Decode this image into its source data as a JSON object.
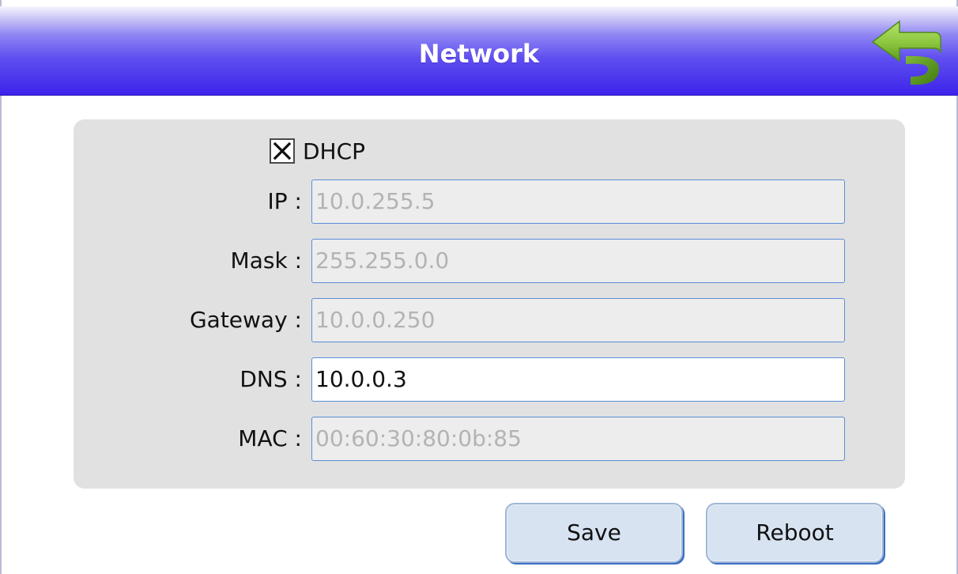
{
  "window": {
    "title": "Network"
  },
  "icons": {
    "back": "back-arrow-icon",
    "checkbox_mark": "x-check-icon"
  },
  "colors": {
    "titlebar_top": "#c9c4f6",
    "titlebar_bottom": "#3c22ea",
    "panel_bg": "#e1e1e1",
    "field_border": "#5b8ed6",
    "button_bg": "#d7e3f1",
    "back_arrow": "#8cc63f"
  },
  "form": {
    "dhcp": {
      "label": "DHCP",
      "checked": true
    },
    "ip": {
      "label": "IP :",
      "value": "10.0.255.5",
      "enabled": false
    },
    "mask": {
      "label": "Mask :",
      "value": "255.255.0.0",
      "enabled": false
    },
    "gateway": {
      "label": "Gateway :",
      "value": "10.0.0.250",
      "enabled": false
    },
    "dns": {
      "label": "DNS :",
      "value": "10.0.0.3",
      "enabled": true
    },
    "mac": {
      "label": "MAC :",
      "value": "00:60:30:80:0b:85",
      "enabled": false
    }
  },
  "buttons": {
    "save": "Save",
    "reboot": "Reboot"
  }
}
